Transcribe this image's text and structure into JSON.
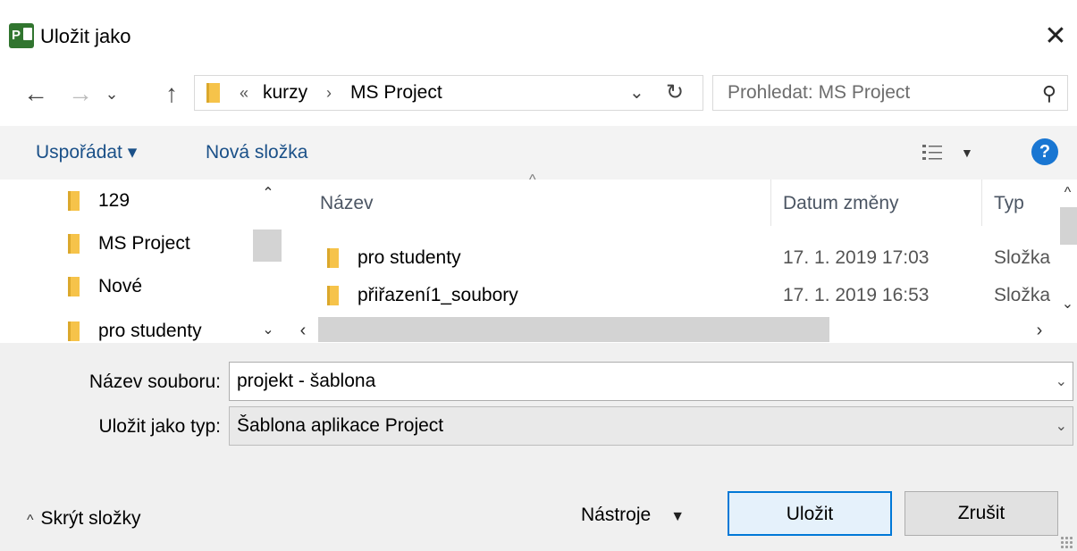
{
  "dialog": {
    "title": "Uložit jako",
    "app_icon_letter": "P",
    "close_glyph": "✕"
  },
  "nav": {
    "back_glyph": "←",
    "forward_glyph": "→",
    "recent_glyph": "⌄",
    "up_glyph": "↑",
    "address": {
      "separator_root": "«",
      "crumbs": [
        "kurzy",
        "MS Project"
      ],
      "separator": "›",
      "dropdown_glyph": "⌄",
      "refresh_glyph": "↻"
    },
    "search": {
      "placeholder": "Prohledat: MS Project",
      "icon_glyph": "⚲"
    }
  },
  "toolbar": {
    "organize_label": "Uspořádat ▾",
    "new_folder_label": "Nová složka",
    "view_dropdown_glyph": "▼",
    "help_glyph": "?"
  },
  "nav_pane": {
    "items": [
      {
        "label": "129"
      },
      {
        "label": "MS Project"
      },
      {
        "label": "Nové"
      },
      {
        "label": "pro studenty"
      }
    ],
    "scroll_up_glyph": "⌃",
    "scroll_down_glyph": "⌄"
  },
  "file_list": {
    "sort_glyph": "^",
    "columns": {
      "name": "Název",
      "date": "Datum změny",
      "type": "Typ"
    },
    "rows": [
      {
        "name": "pro studenty",
        "date": "17. 1. 2019 17:03",
        "type": "Složka"
      },
      {
        "name": "přiřazení1_soubory",
        "date": "17. 1. 2019 16:53",
        "type": "Složka"
      }
    ],
    "scroll_up_glyph": "^",
    "scroll_down_glyph": "⌄",
    "scroll_left_glyph": "‹",
    "scroll_right_glyph": "›"
  },
  "form": {
    "filename_label": "Název souboru:",
    "filename_value": "projekt - šablona",
    "filetype_label": "Uložit jako typ:",
    "filetype_value": "Šablona aplikace Project",
    "chevron_glyph": "⌄"
  },
  "footer": {
    "hide_folders_caret": "^",
    "hide_folders_label": "Skrýt složky",
    "tools_label": "Nástroje",
    "tools_glyph": "▼",
    "save_label": "Uložit",
    "cancel_label": "Zrušit"
  },
  "colors": {
    "accent": "#0078d7",
    "link": "#1a5088",
    "folder": "#f6c34a",
    "app_icon": "#31752f",
    "help": "#1976d2"
  }
}
